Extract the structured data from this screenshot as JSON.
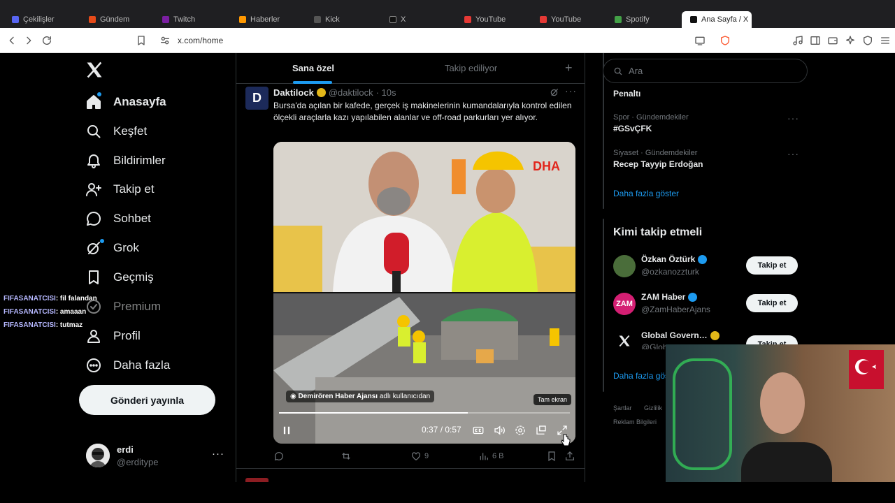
{
  "browser": {
    "url": "x.com/home",
    "tabs": [
      {
        "label": "Çekilişler",
        "color": "#5865f2"
      },
      {
        "label": "Gündem",
        "color": "#e64a19"
      },
      {
        "label": "Twitch",
        "color": "#7b1fa2"
      },
      {
        "label": "Haberler",
        "color": "#ff9800"
      },
      {
        "label": "Kick",
        "color": "#555555"
      },
      {
        "label": "X",
        "color": "#111111"
      },
      {
        "label": "YouTube",
        "color": "#e53935"
      },
      {
        "label": "YouTube",
        "color": "#e53935"
      },
      {
        "label": "Spotify",
        "color": "#43a047"
      },
      {
        "label": "Ana Sayfa / X",
        "color": "#111111"
      }
    ]
  },
  "nav": {
    "items": [
      {
        "label": "Anasayfa",
        "icon": "home-icon"
      },
      {
        "label": "Keşfet",
        "icon": "search-icon"
      },
      {
        "label": "Bildirimler",
        "icon": "bell-icon"
      },
      {
        "label": "Takip et",
        "icon": "follow-icon"
      },
      {
        "label": "Sohbet",
        "icon": "chat-icon"
      },
      {
        "label": "Grok",
        "icon": "grok-icon"
      },
      {
        "label": "Geçmiş",
        "icon": "bookmark-icon"
      },
      {
        "label": "Premium",
        "icon": "premium-icon"
      },
      {
        "label": "Profil",
        "icon": "profile-icon"
      },
      {
        "label": "Daha fazla",
        "icon": "more-icon"
      }
    ],
    "post_button": "Gönderi yayınla",
    "user": {
      "name": "erdi",
      "handle": "@erditype"
    }
  },
  "chat_overlay": [
    {
      "user": "FIFASANATCISI",
      "msg": ": fil falandan"
    },
    {
      "user": "FIFASANATCISI",
      "msg": ": amaaan"
    },
    {
      "user": "FIFASANATCISI",
      "msg": ": tutmaz"
    }
  ],
  "feed": {
    "tabs": [
      "Sana özel",
      "Takip ediliyor"
    ],
    "active_tab": "Sana özel",
    "tweet": {
      "name": "Daktilock",
      "handle": "@daktilock",
      "time": "· 10s",
      "avatar_letter": "D",
      "text": "Bursa'da açılan bir kafede, gerçek iş makinelerinin kumandalarıyla kontrol edilen ölçekli araçlarla kazı yapılabilen alanlar ve off-road parkurları yer alıyor.",
      "video": {
        "watermark": "DHA",
        "caption_user": "Demirören Haber Ajansı",
        "caption_rest": " adlı kullanıcıdan",
        "fullscreen_tip": "Tam ekran",
        "time": "0:37 / 0:57",
        "progress": 0.649
      },
      "stats": {
        "likes": "9",
        "views": "6 B"
      }
    }
  },
  "sidebar": {
    "search_placeholder": "Ara",
    "trends": [
      {
        "category": "",
        "title": "Penaltı"
      },
      {
        "category": "Spor · Gündemdekiler",
        "title": "#GSvÇFK"
      },
      {
        "category": "Siyaset · Gündemdekiler",
        "title": "Recep Tayyip Erdoğan"
      }
    ],
    "show_more": "Daha fazla göster",
    "who_to_follow": {
      "title": "Kimi takip etmeli",
      "accounts": [
        {
          "name": "Özkan Öztürk",
          "handle": "@ozkanozzturk",
          "follow": "Takip et",
          "avatar_color": "#4a6d3a"
        },
        {
          "name": "ZAM Haber",
          "handle": "@ZamHaberAjans",
          "follow": "Takip et",
          "avatar_color": "#d41f73"
        },
        {
          "name": "Global Govern…",
          "handle": "@Glob",
          "follow": "Takip et",
          "avatar_color": "#000000"
        }
      ],
      "show_more": "Daha fazla gös"
    },
    "footer": [
      "Şartlar",
      "Gizlilik",
      "Reklam Bilgileri"
    ]
  }
}
